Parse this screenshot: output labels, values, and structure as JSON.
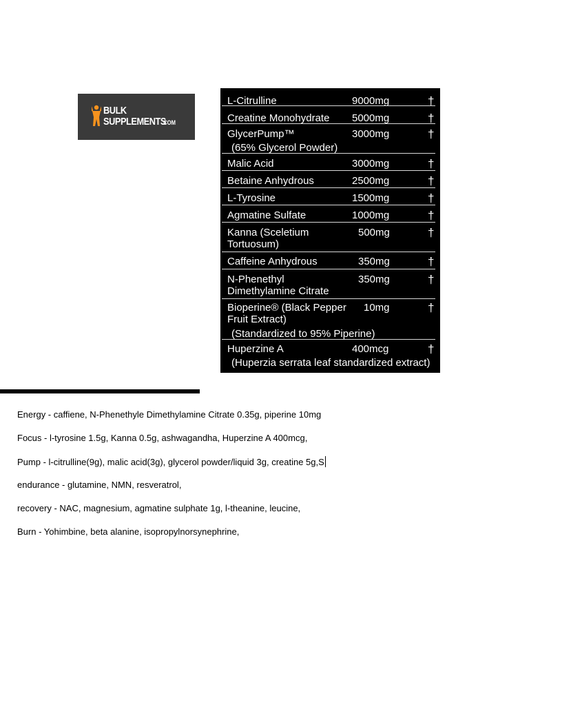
{
  "logo": {
    "line1": "BULK",
    "line2": "SUPPLEMENTS",
    "suffix": ".COM",
    "colors": {
      "background": "#3a3a3a",
      "figure": "#f7931e",
      "text": "#ffffff"
    }
  },
  "supplement_table": {
    "rows": [
      {
        "name": "L-Citrulline",
        "amount": "9000mg",
        "mark": "†"
      },
      {
        "name": "Creatine Monohydrate",
        "amount": "5000mg",
        "mark": "†"
      },
      {
        "name": "GlycerPump™",
        "amount": "3000mg",
        "mark": "†",
        "sub": "(65% Glycerol Powder)"
      },
      {
        "name": "Malic Acid",
        "amount": "3000mg",
        "mark": "†"
      },
      {
        "name": "Betaine Anhydrous",
        "amount": "2500mg",
        "mark": "†"
      },
      {
        "name": "L-Tyrosine",
        "amount": "1500mg",
        "mark": "†"
      },
      {
        "name": "Agmatine Sulfate",
        "amount": "1000mg",
        "mark": "†"
      },
      {
        "name": "Kanna (Sceletium\nTortuosum)",
        "amount": "500mg",
        "mark": "†"
      },
      {
        "name": "Caffeine Anhydrous",
        "amount": "350mg",
        "mark": "†"
      },
      {
        "name": "N-Phenethyl\nDimethylamine Citrate",
        "amount": "350mg",
        "mark": "†"
      },
      {
        "name": "Bioperine® (Black Pepper\nFruit Extract)",
        "amount": "10mg",
        "mark": "†",
        "sub": "(Standardized to 95% Piperine)"
      },
      {
        "name": "Huperzine A",
        "amount": "400mcg",
        "mark": "†",
        "sub": "(Huperzia serrata leaf standardized extract)"
      }
    ]
  },
  "notes": [
    "Energy - caffiene, N-Phenethyle Dimethylamine Citrate 0.35g, piperine 10mg",
    "Focus - l-tyrosine 1.5g, Kanna 0.5g, ashwagandha, Huperzine A 400mcg,",
    "Pump - l-citrulline(9g), malic acid(3g), glycerol powder/liquid 3g, creatine 5g,S",
    "endurance - glutamine, NMN, resveratrol,",
    "recovery - NAC, magnesium, agmatine sulphate 1g, l-theanine, leucine,",
    "Burn - Yohimbine, beta alanine, isopropylnorsynephrine,"
  ]
}
